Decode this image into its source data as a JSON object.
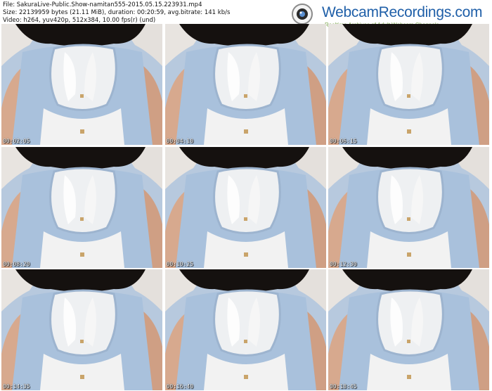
{
  "header": {
    "file_line": "File: SakuraLive-Public.Show-namitan555-2015.05.15.223931.mp4",
    "size_line": "Size: 22139959 bytes (21.11 MiB), duration: 00:20:59, avg.bitrate: 141 kb/s",
    "video_line": "Video: h264, yuv420p, 512x384, 10.00 fps(r) (und)"
  },
  "logo": {
    "wordmark": "WebcamRecordings.com",
    "tagline": "Realtime Archives of Adult Webcam Channels",
    "icon": "webcam-icon"
  },
  "thumbnails": [
    {
      "timestamp": "00:02:05"
    },
    {
      "timestamp": "00:04:10"
    },
    {
      "timestamp": "00:06:15"
    },
    {
      "timestamp": "00:08:20"
    },
    {
      "timestamp": "00:10:25"
    },
    {
      "timestamp": "00:12:30"
    },
    {
      "timestamp": "00:14:35"
    },
    {
      "timestamp": "00:16:40"
    },
    {
      "timestamp": "00:18:45"
    }
  ],
  "colors": {
    "dress": "#a9c1dc",
    "blouse": "#eef0f2",
    "hair": "#15110f",
    "logo_blue": "#1f5fa8",
    "logo_green": "#7aa64a"
  }
}
